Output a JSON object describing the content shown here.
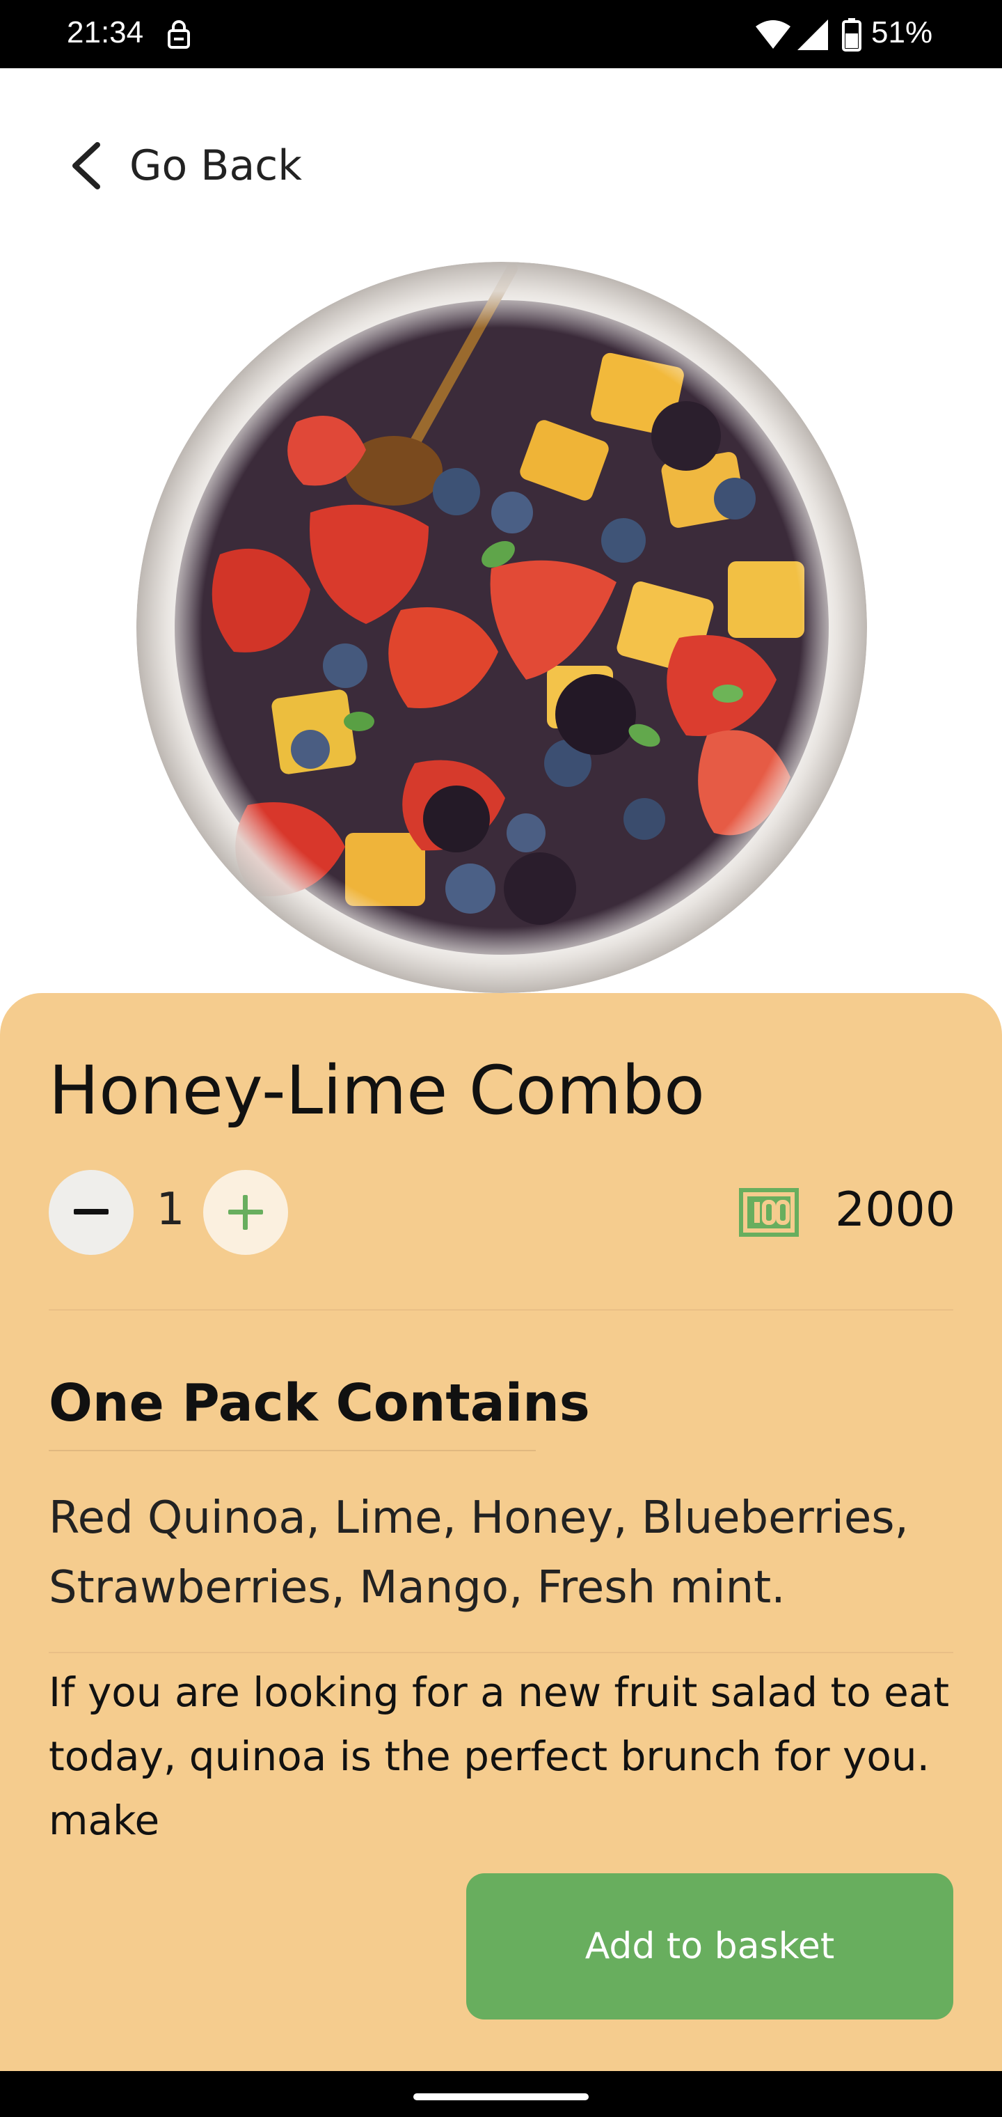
{
  "status_bar": {
    "time": "21:34",
    "battery_percent": "51%",
    "icons": [
      "lock-icon",
      "wifi-icon",
      "signal-icon",
      "battery-icon"
    ]
  },
  "nav": {
    "back_label": "Go Back",
    "back_icon": "chevron-left-icon"
  },
  "product": {
    "image_description_icon": "fruit-salad-bowl-image",
    "title": "Honey-Lime Combo",
    "quantity": "1",
    "price": "2000",
    "price_icon": "money-icon"
  },
  "contents": {
    "heading": "One Pack Contains",
    "ingredients": "Red Quinoa, Lime, Honey, Blueberries, Strawberries, Mango, Fresh mint.",
    "description": "If you are looking for a new fruit salad to eat today, quinoa is the perfect brunch for you. make"
  },
  "actions": {
    "add_to_basket_label": "Add to basket"
  },
  "colors": {
    "panel_bg": "#f5cc8e",
    "accent_green": "#68ae5e",
    "minus_button_bg": "#efeeeb",
    "plus_button_bg": "#fbf0df"
  }
}
